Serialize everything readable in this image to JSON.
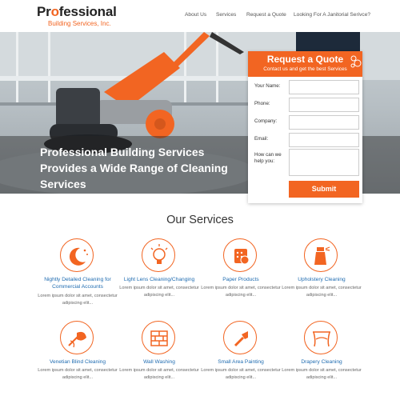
{
  "header": {
    "logo_prefix": "Pr",
    "logo_o": "o",
    "logo_suffix": "fessional",
    "logo_sub": "Building Services, Inc.",
    "nav": [
      "About Us",
      "Services",
      "Request a Quote",
      "Looking For A Janitorial Serivce?"
    ]
  },
  "hero": {
    "title": "Professional Building Services Provides a Wide Range of Cleaning Services"
  },
  "quote": {
    "title": "Request a Quote",
    "subtitle": "Contact us and get the best Services",
    "fields": [
      "Your Name:",
      "Phone:",
      "Company:",
      "Email:",
      "How can we help you:"
    ],
    "submit": "Submit"
  },
  "services": {
    "title": "Our Services",
    "items": [
      {
        "name": "Nightly Detailed Cleaning for Commercial Accounts",
        "desc": "Lorem ipsum dolor sit amet, consectetur adipiscing elit...",
        "icon": "moon-stars-icon"
      },
      {
        "name": "Light Lens Cleaning/Changing",
        "desc": "Lorem ipsum dolor sit amet, consectetur adipiscing elit...",
        "icon": "light-bulb-icon"
      },
      {
        "name": "Paper Products",
        "desc": "Lorem ipsum dolor sit amet, consectetur adipiscing elit...",
        "icon": "paper-roll-icon"
      },
      {
        "name": "Upholstery Cleaning",
        "desc": "Lorem ipsum dolor sit amet, consectetur adipiscing elit...",
        "icon": "spray-bottle-icon"
      },
      {
        "name": "Venetian Blind Cleaning",
        "desc": "Lorem ipsum dolor sit amet, consectetur adipiscing elit...",
        "icon": "feather-duster-icon"
      },
      {
        "name": "Wall Washing",
        "desc": "Lorem ipsum dolor sit amet, consectetur adipiscing elit...",
        "icon": "brick-wall-icon"
      },
      {
        "name": "Small Area Painting",
        "desc": "Lorem ipsum dolor sit amet, consectetur adipiscing elit...",
        "icon": "paint-brush-icon"
      },
      {
        "name": "Drapery Cleaning",
        "desc": "Lorem ipsum dolor sit amet, consectetur adipiscing elit...",
        "icon": "drapery-icon"
      }
    ]
  },
  "colors": {
    "accent": "#f26522",
    "link": "#1e6bb0"
  }
}
